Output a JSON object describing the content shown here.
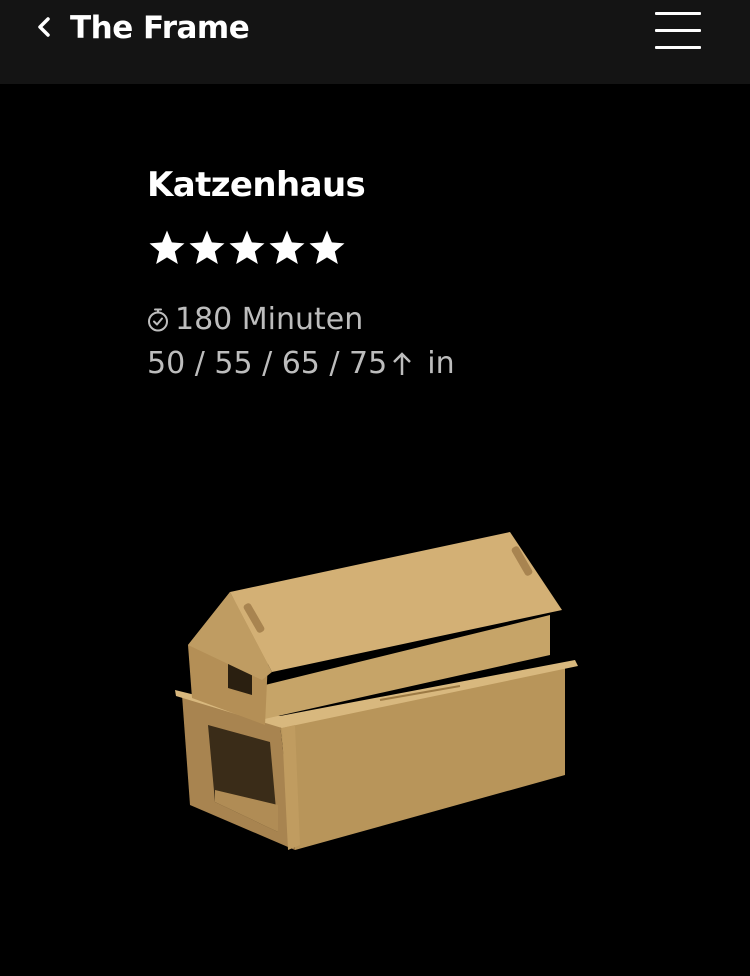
{
  "header": {
    "back_icon": "chevron-left-icon",
    "title": "The Frame",
    "menu_icon": "hamburger-menu-icon"
  },
  "product": {
    "title": "Katzenhaus",
    "rating": {
      "stars": 5,
      "max": 5,
      "icon": "star-icon",
      "color": "#ffffff"
    },
    "duration_icon": "stopwatch-icon",
    "duration": "180 Minuten",
    "sizes": "50 / 55 / 65 / 75",
    "sizes_icon": "arrow-up-icon",
    "unit": "in"
  },
  "colors": {
    "background": "#000000",
    "header": "#141414",
    "text_primary": "#ffffff",
    "text_secondary": "#bdbdbd",
    "cardboard": "#c9a66b"
  }
}
